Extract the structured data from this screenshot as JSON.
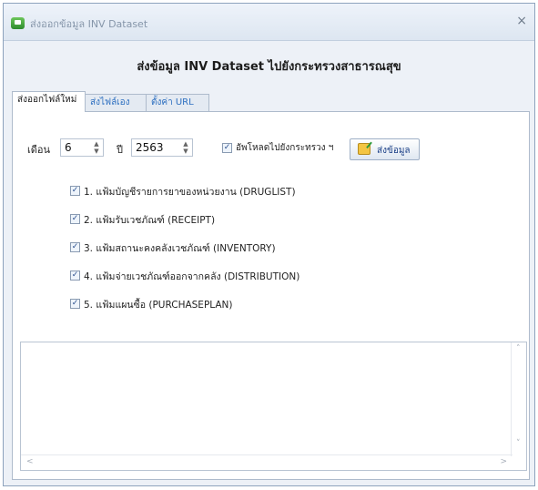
{
  "window": {
    "title": "ส่งออกข้อมูล INV Dataset",
    "close_glyph": "×"
  },
  "heading": "ส่งข้อมูล INV Dataset ไปยังกระทรวงสาธารณสุข",
  "tabs": [
    {
      "label": "ส่งออกไฟล์ใหม่",
      "active": true
    },
    {
      "label": "ส่งไฟล์เอง",
      "active": false
    },
    {
      "label": "ตั้งค่า URL",
      "active": false
    }
  ],
  "form": {
    "month_label": "เดือน",
    "month_value": "6",
    "year_label": "ปี",
    "year_value": "2563",
    "upload_checkbox_label": "อัพโหลดไปยังกระทรวง ฯ",
    "upload_checked": true,
    "check_glyph": "✓",
    "send_button_label": "ส่งข้อมูล",
    "spinner_glyphs": {
      "up": "▲",
      "down": "▼"
    }
  },
  "files": [
    {
      "label": "1. แฟ้มบัญชีรายการยาของหน่วยงาน (DRUGLIST)",
      "checked": true
    },
    {
      "label": "2. แฟ้มรับเวชภัณฑ์ (RECEIPT)",
      "checked": true
    },
    {
      "label": "3. แฟ้มสถานะคงคลังเวชภัณฑ์ (INVENTORY)",
      "checked": true
    },
    {
      "label": "4. แฟ้มจ่ายเวชภัณฑ์ออกจากคลัง (DISTRIBUTION)",
      "checked": true
    },
    {
      "label": "5. แฟ้มแผนซื้อ (PURCHASEPLAN)",
      "checked": true
    }
  ],
  "log": {
    "text": "",
    "scroll_glyphs": {
      "up": "˄",
      "down": "˅",
      "left": "<",
      "right": ">"
    }
  },
  "colors": {
    "tab_link": "#2d6fc0",
    "window_bg": "#edf1f7",
    "check": "#2b4f8e"
  }
}
